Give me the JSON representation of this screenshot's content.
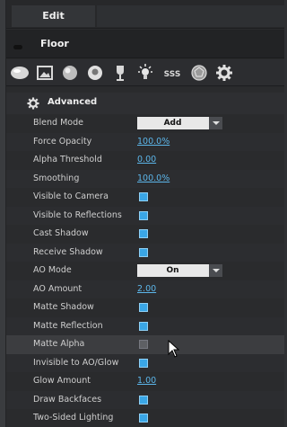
{
  "tabs": {
    "active": "Edit"
  },
  "object": {
    "name": "Floor"
  },
  "toolbar": {
    "icons": [
      "sphere-pill-icon",
      "image-icon",
      "sphere-icon",
      "sphere-light-icon",
      "glass-icon",
      "light-bulb-icon",
      "sss-icon",
      "geodesic-sphere-icon",
      "gear-icon"
    ],
    "sss_label": "SSS"
  },
  "section": {
    "title": "Advanced"
  },
  "properties": [
    {
      "label": "Blend Mode",
      "type": "dropdown",
      "value": "Add"
    },
    {
      "label": "Force Opacity",
      "type": "number",
      "value": "100.0%"
    },
    {
      "label": "Alpha Threshold",
      "type": "number",
      "value": "0.00"
    },
    {
      "label": "Smoothing",
      "type": "number",
      "value": "100.0%"
    },
    {
      "label": "Visible to Camera",
      "type": "checkbox",
      "checked": true
    },
    {
      "label": "Visible to Reflections",
      "type": "checkbox",
      "checked": true
    },
    {
      "label": "Cast Shadow",
      "type": "checkbox",
      "checked": true
    },
    {
      "label": "Receive Shadow",
      "type": "checkbox",
      "checked": true
    },
    {
      "label": "AO Mode",
      "type": "dropdown",
      "value": "On"
    },
    {
      "label": "AO Amount",
      "type": "number",
      "value": "2.00"
    },
    {
      "label": "Matte Shadow",
      "type": "checkbox",
      "checked": true
    },
    {
      "label": "Matte Reflection",
      "type": "checkbox",
      "checked": true
    },
    {
      "label": "Matte Alpha",
      "type": "checkbox",
      "checked": false
    },
    {
      "label": "Invisible to AO/Glow",
      "type": "checkbox",
      "checked": true
    },
    {
      "label": "Glow Amount",
      "type": "number",
      "value": "1.00"
    },
    {
      "label": "Draw Backfaces",
      "type": "checkbox",
      "checked": true
    },
    {
      "label": "Two-Sided Lighting",
      "type": "checkbox",
      "checked": true
    }
  ],
  "colors": {
    "accent": "#3aa6e6",
    "link": "#5cb6ea",
    "panel": "#2a2b2d"
  }
}
